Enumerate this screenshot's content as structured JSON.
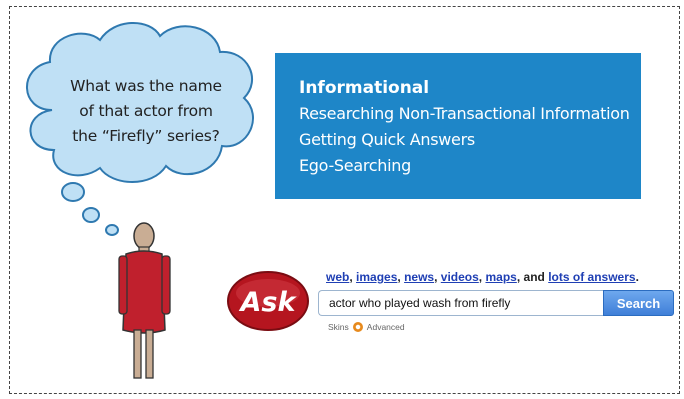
{
  "thought_bubble": {
    "lines": [
      "What was the name",
      "of that actor from",
      "the “Firefly” series?"
    ]
  },
  "info_box": {
    "title": "Informational",
    "items": [
      "Researching Non-Transactional Information",
      "Getting Quick Answers",
      "Ego-Searching"
    ]
  },
  "ask": {
    "logo_text": "Ask",
    "nav": {
      "links": [
        "web",
        "images",
        "news",
        "videos",
        "maps"
      ],
      "separator": ",",
      "conjunction": "and",
      "last_link": "lots of answers",
      "end": "."
    },
    "search": {
      "value": "actor who played wash from firefly",
      "button_label": "Search"
    },
    "sub_links": {
      "skins": "Skins",
      "advanced": "Advanced"
    }
  },
  "colors": {
    "info_box_bg": "#1e86c8",
    "cloud_fill": "#bfe0f5",
    "person_body": "#c0202d",
    "logo_red": "#b5151f",
    "link_blue": "#1f3fb4"
  }
}
